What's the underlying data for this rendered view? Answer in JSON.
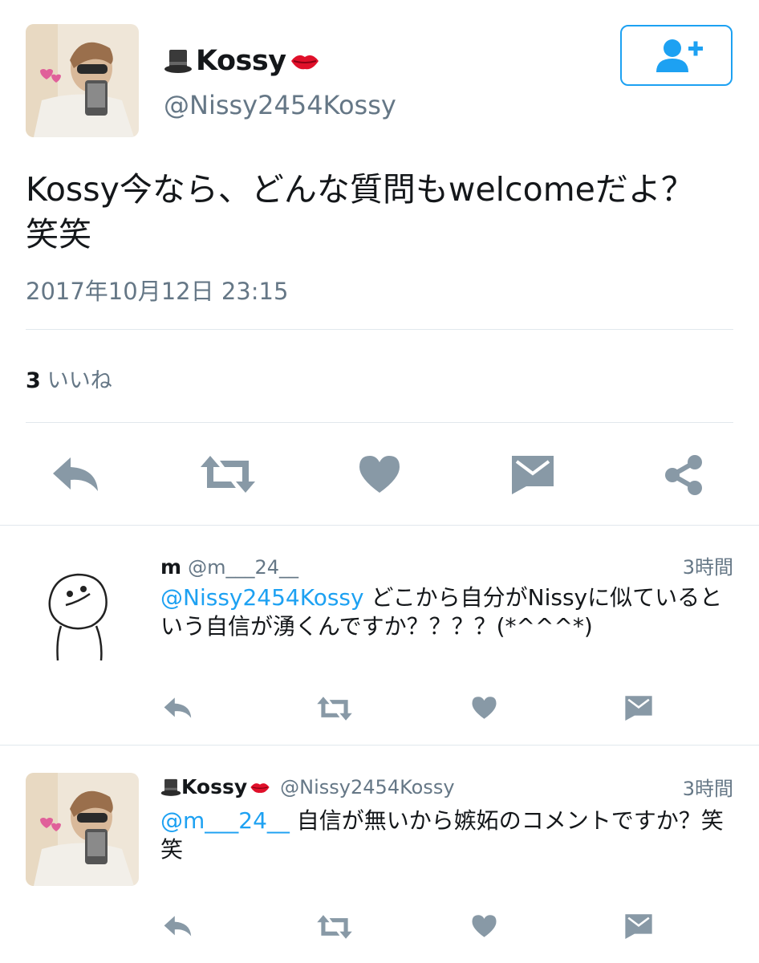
{
  "main_tweet": {
    "display_name": "Kossy",
    "handle": "@Nissy2454Kossy",
    "text_line1": "Kossy今なら、どんな質問もwelcomeだよ？",
    "text_line2": "笑笑",
    "timestamp": "2017年10月12日 23:15",
    "likes_count": "3",
    "likes_label": "いいね",
    "name_prefix_icon": "top-hat-emoji",
    "name_suffix_icon": "lips-emoji"
  },
  "follow_button": {
    "icon": "follow-user-plus-icon",
    "accent": "#1da1f2"
  },
  "replies": [
    {
      "display_name": "m",
      "handle": "@m___24__",
      "time": "3時間",
      "mention": "@Nissy2454Kossy",
      "text_line1": " どこから自分がNissyに似ていると",
      "text_line2": "いう自信が湧くんですか？？？？(*^^^*)"
    },
    {
      "display_name": "Kossy",
      "handle": "@Nissy2454Kossy",
      "time": "3時間",
      "mention": "@m___24__",
      "text_line1": " 自信が無いから嫉妬のコメントですか？笑",
      "text_line2": "笑"
    }
  ],
  "colors": {
    "accent": "#1da1f2",
    "icon_gray": "#8899a6",
    "muted_text": "#657786",
    "divider": "#e1e8ed"
  }
}
